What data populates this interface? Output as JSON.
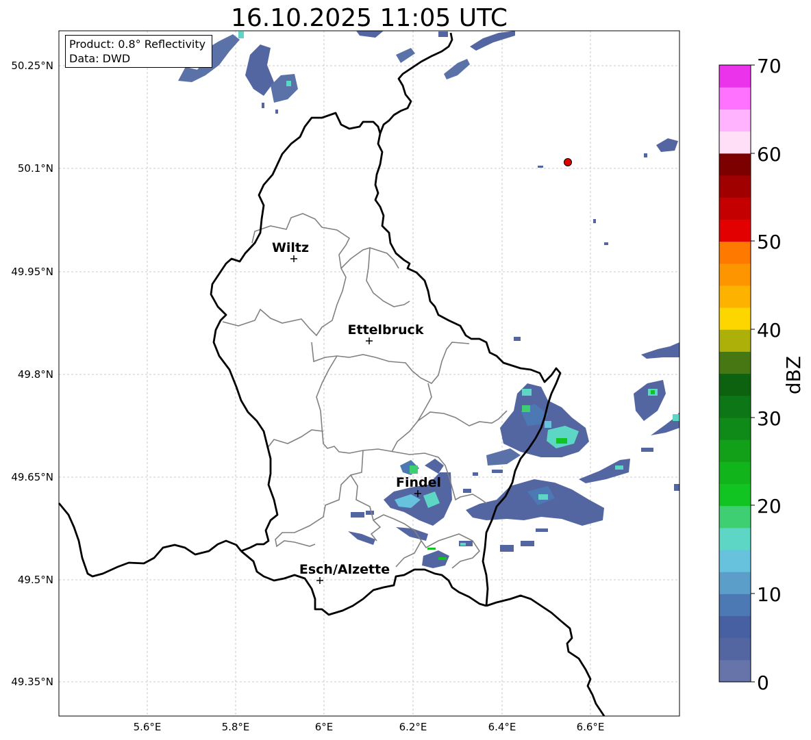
{
  "title": "16.10.2025 11:05 UTC",
  "info": {
    "product": "Product: 0.8° Reflectivity",
    "data": "Data: DWD"
  },
  "axes": {
    "lat_ticks": [
      "50.25°N",
      "50.1°N",
      "49.95°N",
      "49.8°N",
      "49.65°N",
      "49.5°N",
      "49.35°N"
    ],
    "lon_ticks": [
      "5.6°E",
      "5.8°E",
      "6°E",
      "6.2°E",
      "6.4°E",
      "6.6°E"
    ]
  },
  "colorbar": {
    "label": "dBZ",
    "ticks": [
      "0",
      "10",
      "20",
      "30",
      "40",
      "50",
      "60",
      "70"
    ],
    "colors": [
      "#6674a9",
      "#5466a2",
      "#4660a2",
      "#4c78b3",
      "#5b9ec9",
      "#67c3dd",
      "#5ed6c6",
      "#3ecf73",
      "#12c421",
      "#12b41b",
      "#12a019",
      "#0f8a18",
      "#0d7617",
      "#0c620f",
      "#467712",
      "#acb008",
      "#fdd600",
      "#fdb200",
      "#fd9500",
      "#fd7900",
      "#e30000",
      "#c50000",
      "#a10000",
      "#7d0000",
      "#ffdff7",
      "#ffb3ff",
      "#ff71ff",
      "#ec33ec"
    ]
  },
  "cities": [
    {
      "name": "Wiltz"
    },
    {
      "name": "Ettelbruck"
    },
    {
      "name": "Findel"
    },
    {
      "name": "Esch/Alzette"
    }
  ],
  "marker": {
    "color": "#e00000"
  }
}
